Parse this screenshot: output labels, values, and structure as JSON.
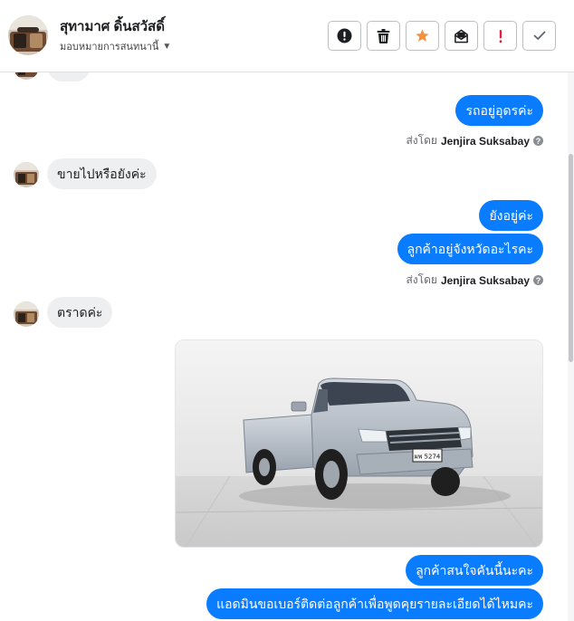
{
  "header": {
    "contact_name": "สุทามาศ ดิ้นสวัสดิ์",
    "assign_label": "มอบหมายการสนทนานี้",
    "actions": [
      {
        "name": "mark-spam",
        "icon": "exclamation-circle-icon"
      },
      {
        "name": "delete",
        "icon": "trash-icon"
      },
      {
        "name": "star",
        "icon": "star-icon",
        "color": "#f7923b"
      },
      {
        "name": "mark-unread",
        "icon": "envelope-icon"
      },
      {
        "name": "follow-up",
        "icon": "exclamation-icon",
        "color": "#e41e3f"
      },
      {
        "name": "mark-done",
        "icon": "checkmark-icon"
      }
    ]
  },
  "messages": [
    {
      "side": "in",
      "text": "ครับ"
    },
    {
      "side": "out",
      "text": "รถอยู่อุดรค่ะ"
    },
    {
      "side": "meta",
      "prefix": "ส่งโดย",
      "sender": "Jenjira Suksabay"
    },
    {
      "side": "in",
      "text": "ขายไปหรือยังค่ะ"
    },
    {
      "side": "out",
      "text": "ยังอยู่ค่ะ"
    },
    {
      "side": "out",
      "text": "ลูกค้าอยู่จังหวัดอะไรคะ"
    },
    {
      "side": "meta",
      "prefix": "ส่งโดย",
      "sender": "Jenjira Suksabay"
    },
    {
      "side": "in",
      "text": "ตราดค่ะ"
    },
    {
      "side": "out",
      "type": "image",
      "plate": "ผพ 5274"
    },
    {
      "side": "out",
      "text": "ลูกค้าสนใจคันนี้นะคะ"
    },
    {
      "side": "out",
      "text": "แอดมินขอเบอร์ติดต่อลูกค้าเพื่อพูดคุยรายละเอียดได้ไหมคะ"
    }
  ],
  "colors": {
    "outgoing": "#0a7cff",
    "incoming": "#eeeff1",
    "star": "#f7923b",
    "alert": "#e41e3f"
  }
}
